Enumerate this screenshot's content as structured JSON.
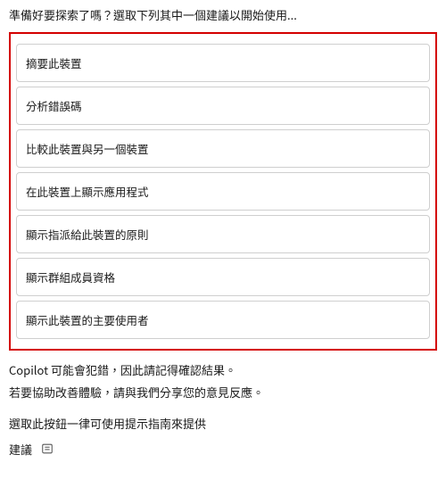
{
  "intro": "準備好要探索了嗎？選取下列其中一個建議以開始使用...",
  "suggestions": [
    "摘要此裝置",
    "分析錯誤碼",
    "比較此裝置與另一個裝置",
    "在此裝置上顯示應用程式",
    "顯示指派給此裝置的原則",
    "顯示群組成員資格",
    "顯示此裝置的主要使用者"
  ],
  "disclaimer": "Copilot 可能會犯錯，因此請記得確認結果。",
  "feedback": "若要協助改善體驗，請與我們分享您的意見反應。",
  "guide_text": "選取此按鈕一律可使用提示指南來提供",
  "guide_label": "建議"
}
